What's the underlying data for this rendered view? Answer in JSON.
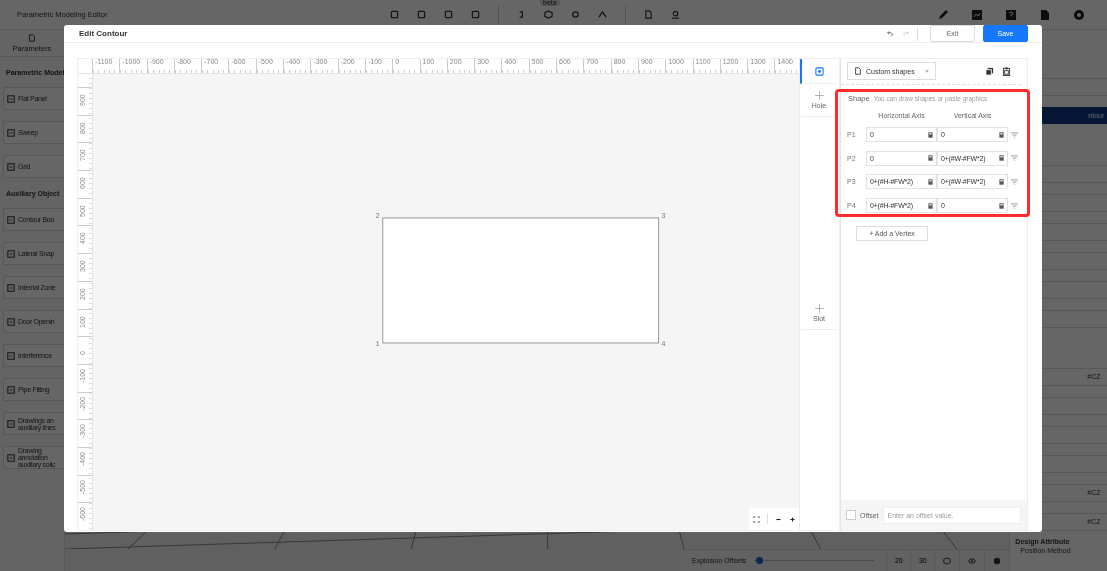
{
  "app": {
    "title": "Parametric Modeling Editor",
    "badge": "beta"
  },
  "sidebar": {
    "tab": "Parameters",
    "sections": [
      {
        "title": "Parametric Model",
        "items": [
          {
            "lines": [
              "Flat Panel"
            ]
          },
          {
            "lines": [
              "Sweep"
            ]
          },
          {
            "lines": [
              "Grid"
            ]
          }
        ]
      },
      {
        "title": "Auxiliary Object",
        "items": [
          {
            "lines": [
              "Contour Bou"
            ]
          },
          {
            "lines": [
              "Lateral Snap"
            ]
          },
          {
            "lines": [
              "Internal Zone"
            ]
          },
          {
            "lines": [
              "Door Openin"
            ]
          },
          {
            "lines": [
              "Interference"
            ]
          },
          {
            "lines": [
              "Pipe Fitting"
            ]
          },
          {
            "lines": [
              "Drawings an",
              "auxiliary lines"
            ]
          },
          {
            "lines": [
              "Drawing",
              "annotation",
              "auxiliary solic"
            ]
          }
        ]
      }
    ]
  },
  "property_panel": [
    {
      "kind": "chevron"
    },
    {
      "kind": "field"
    },
    {
      "kind": "button",
      "label": "ntour"
    },
    {
      "kind": "chevron"
    },
    {
      "kind": "field"
    },
    {
      "kind": "field"
    },
    {
      "kind": "field"
    },
    {
      "kind": "field"
    },
    {
      "kind": "field"
    },
    {
      "kind": "field"
    },
    {
      "kind": "chevron"
    },
    {
      "kind": "field",
      "value": "#CZ"
    },
    {
      "kind": "field"
    },
    {
      "kind": "field"
    },
    {
      "kind": "select"
    },
    {
      "kind": "field",
      "value": "#CZ"
    },
    {
      "kind": "field",
      "value": "#CZ"
    },
    {
      "kind": "heading",
      "label": "Design Attribute"
    },
    {
      "kind": "label",
      "label": "Position Method"
    }
  ],
  "bottom_bar": {
    "label": "Explosion Offsets",
    "level": 0.02,
    "buttons": [
      "20",
      "30"
    ]
  },
  "dialog": {
    "title": "Edit Contour",
    "redo_disabled": true,
    "buttons": [
      {
        "label": "Exit",
        "kind": "secondary"
      },
      {
        "label": "Save",
        "kind": "primary"
      }
    ],
    "ruler": {
      "x_labels": [
        "-1100",
        "-1000",
        "-900",
        "-800",
        "-700",
        "-600",
        "-500",
        "-400",
        "-300",
        "-200",
        "-100",
        "0",
        "100",
        "200",
        "300",
        "400",
        "500",
        "600",
        "700",
        "800",
        "900",
        "1000",
        "1100",
        "1200",
        "1300",
        "1400"
      ],
      "y_labels": [
        "900",
        "800",
        "700",
        "600",
        "500",
        "400",
        "300",
        "200",
        "100",
        "0",
        "-100",
        "-200",
        "-300",
        "-400",
        "-500",
        "-600"
      ]
    },
    "vertices": [
      {
        "label": "2"
      },
      {
        "label": "3"
      },
      {
        "label": "1"
      },
      {
        "label": "4"
      }
    ],
    "tools": [
      {
        "kind": "shape",
        "selected": true
      },
      {
        "kind": "add",
        "label": "Hole",
        "selected": false
      },
      {
        "kind": "add",
        "label": "Slot",
        "selected": false
      }
    ],
    "shape_panel": {
      "shape_type": "Custom shapes",
      "section_label": "Shape",
      "hint": "You can draw shapes or paste graphics",
      "columns": [
        "Horizontal Axis",
        "Vertical Axis"
      ],
      "points": [
        {
          "label": "P1",
          "horizontal": "0",
          "vertical": "0"
        },
        {
          "label": "P2",
          "horizontal": "0",
          "vertical": "0+(#W-#FW*2)"
        },
        {
          "label": "P3",
          "horizontal": "0+(#H-#FW*2)",
          "vertical": "0+(#W-#FW*2)"
        },
        {
          "label": "P4",
          "horizontal": "0+(#H-#FW*2)",
          "vertical": "0"
        }
      ],
      "add_button": "+ Add a Vertex",
      "offset": {
        "label": "Offset",
        "checked": false,
        "placeholder": "Enter an offset value."
      }
    }
  }
}
